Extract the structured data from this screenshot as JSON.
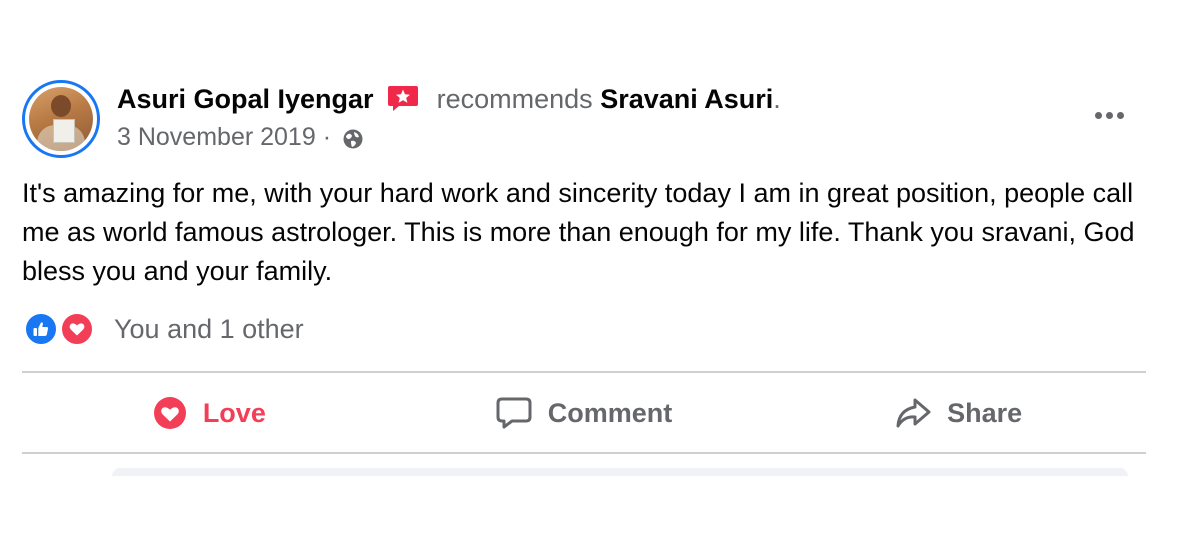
{
  "post": {
    "author": "Asuri Gopal Iyengar",
    "action_verb": "recommends",
    "target": "Sravani Asuri",
    "period": ".",
    "date": "3 November 2019",
    "separator": "·",
    "privacy_icon": "globe-icon",
    "body": "It's amazing for me, with your hard work and sincerity today I am in great position, people call me as world famous astrologer. This is more than enough for my life. Thank you sravani, God bless you and your family."
  },
  "reactions": {
    "types": [
      "like-icon",
      "love-icon"
    ],
    "summary": "You and 1 other"
  },
  "actions": {
    "love_label": "Love",
    "comment_label": "Comment",
    "share_label": "Share"
  },
  "colors": {
    "accent_blue": "#1877f2",
    "love_red": "#f33e58",
    "secondary_text": "#65676b",
    "primary_text": "#050505",
    "divider": "#ced0d4"
  }
}
